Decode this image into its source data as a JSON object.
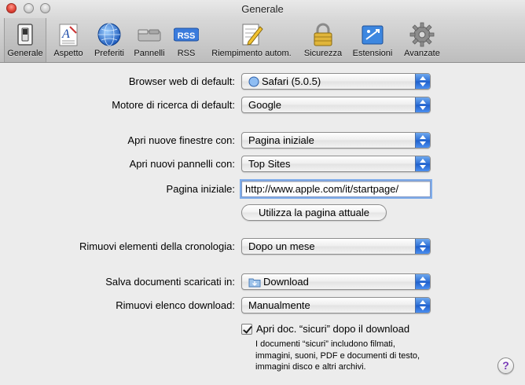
{
  "window": {
    "title": "Generale"
  },
  "toolbar": {
    "items": [
      {
        "label": "Generale",
        "icon": "switch-icon"
      },
      {
        "label": "Aspetto",
        "icon": "fonts-icon"
      },
      {
        "label": "Preferiti",
        "icon": "globe-icon"
      },
      {
        "label": "Pannelli",
        "icon": "tabs-icon"
      },
      {
        "label": "RSS",
        "icon": "rss-icon"
      },
      {
        "label": "Riempimento autom.",
        "icon": "pencil-form-icon"
      },
      {
        "label": "Sicurezza",
        "icon": "lock-icon"
      },
      {
        "label": "Estensioni",
        "icon": "puzzle-icon"
      },
      {
        "label": "Avanzate",
        "icon": "gear-icon"
      }
    ],
    "rss_badge": "RSS",
    "selected": "Generale"
  },
  "form": {
    "default_browser": {
      "label": "Browser web di default:",
      "value": "Safari (5.0.5)"
    },
    "search_engine": {
      "label": "Motore di ricerca di default:",
      "value": "Google"
    },
    "new_windows": {
      "label": "Apri nuove finestre con:",
      "value": "Pagina iniziale"
    },
    "new_tabs": {
      "label": "Apri nuovi pannelli con:",
      "value": "Top Sites"
    },
    "homepage": {
      "label": "Pagina iniziale:",
      "value": "http://www.apple.com/it/startpage/"
    },
    "use_current_page": {
      "label": "Utilizza la pagina attuale"
    },
    "remove_history": {
      "label": "Rimuovi elementi della cronologia:",
      "value": "Dopo un mese"
    },
    "download_location": {
      "label": "Salva documenti scaricati in:",
      "value": "Download"
    },
    "remove_downloads": {
      "label": "Rimuovi elenco download:",
      "value": "Manualmente"
    },
    "open_safe": {
      "label": "Apri doc. “sicuri” dopo il download",
      "checked": true,
      "help_lines": [
        "I documenti “sicuri” includono filmati,",
        "immagini, suoni, PDF e documenti di testo,",
        "immagini disco e altri archivi."
      ]
    }
  },
  "help": {
    "label": "?"
  },
  "colors": {
    "accent": "#2d6fd6",
    "focus_ring": "#7fadea"
  }
}
